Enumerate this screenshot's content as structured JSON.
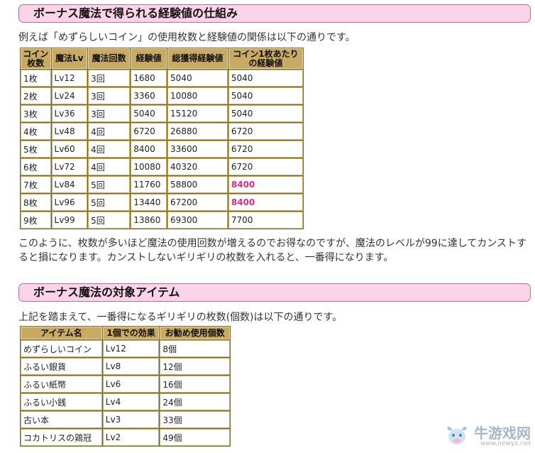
{
  "section1": {
    "title": "ボーナス魔法で得られる経験値の仕組み",
    "intro": "例えば「めずらしいコイン」の使用枚数と経験値の関係は以下の通りです。",
    "headers": [
      "コイン枚数",
      "魔法Lv",
      "魔法回数",
      "経験値",
      "総獲得経験値",
      "コイン1枚あたりの経験値"
    ],
    "rows": [
      [
        "1枚",
        "Lv12",
        "3回",
        "1680",
        "5040",
        "5040"
      ],
      [
        "2枚",
        "Lv24",
        "3回",
        "3360",
        "10080",
        "5040"
      ],
      [
        "3枚",
        "Lv36",
        "3回",
        "5040",
        "15120",
        "5040"
      ],
      [
        "4枚",
        "Lv48",
        "4回",
        "6720",
        "26880",
        "6720"
      ],
      [
        "5枚",
        "Lv60",
        "4回",
        "8400",
        "33600",
        "6720"
      ],
      [
        "6枚",
        "Lv72",
        "4回",
        "10080",
        "40320",
        "6720"
      ],
      [
        "7枚",
        "Lv84",
        "5回",
        "11760",
        "58800",
        "8400"
      ],
      [
        "8枚",
        "Lv96",
        "5回",
        "13440",
        "67200",
        "8400"
      ],
      [
        "9枚",
        "Lv99",
        "5回",
        "13860",
        "69300",
        "7700"
      ]
    ],
    "highlight_color": "#d62c86",
    "note": "このように、枚数が多いほど魔法の使用回数が増えるのでお得なのですが、魔法のレベルが99に達してカンストすると損になります。カンストしないギリギリの枚数を入れると、一番得になります。"
  },
  "section2": {
    "title": "ボーナス魔法の対象アイテム",
    "intro": "上記を踏まえて、一番得になるギリギリの枚数(個数)は以下の通りです。",
    "headers": [
      "アイテム名",
      "1個での効果",
      "お勧め使用個数"
    ],
    "rows": [
      [
        "めずらしいコイン",
        "Lv12",
        "8個"
      ],
      [
        "ふるい銀貨",
        "Lv8",
        "12個"
      ],
      [
        "ふるい紙幣",
        "Lv6",
        "16個"
      ],
      [
        "ふるい小銭",
        "Lv4",
        "24個"
      ],
      [
        "古い本",
        "Lv3",
        "33個"
      ],
      [
        "コカトリスの鶏冠",
        "Lv2",
        "49個"
      ]
    ]
  },
  "watermark": {
    "text": "牛游戏网",
    "url": "www.newyx.net"
  }
}
